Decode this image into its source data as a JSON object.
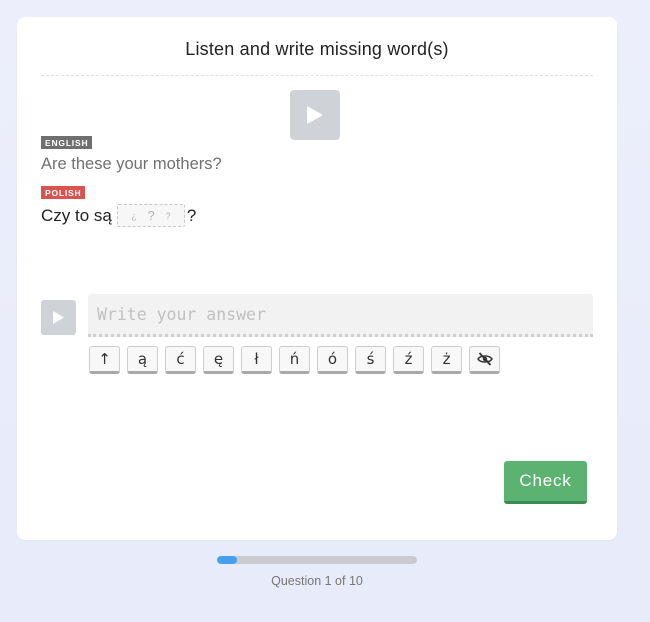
{
  "exercise": {
    "title": "Listen and write missing word(s)",
    "english_badge": "ENGLISH",
    "english_sentence": "Are these your mothers?",
    "polish_badge": "POLISH",
    "polish_before": "Czy to są",
    "polish_gap_glyph": "?",
    "polish_after": "?"
  },
  "answer": {
    "placeholder": "Write your answer",
    "value": ""
  },
  "keyboard": {
    "keys": [
      "↑",
      "ą",
      "ć",
      "ę",
      "ł",
      "ń",
      "ó",
      "ś",
      "ź",
      "ż"
    ],
    "toggle_icon": "eye-slash-icon"
  },
  "actions": {
    "check_label": "Check"
  },
  "progress": {
    "current": 1,
    "total": 10,
    "fraction": 0.1,
    "label": "Question 1 of 10"
  },
  "colors": {
    "accent_green": "#5cb270",
    "progress_blue": "#46a0ee",
    "english_badge": "#6f6f6f",
    "polish_badge": "#d9534f",
    "play_button": "#cfd3d8"
  },
  "icons": {
    "audio_play": "play-icon"
  }
}
